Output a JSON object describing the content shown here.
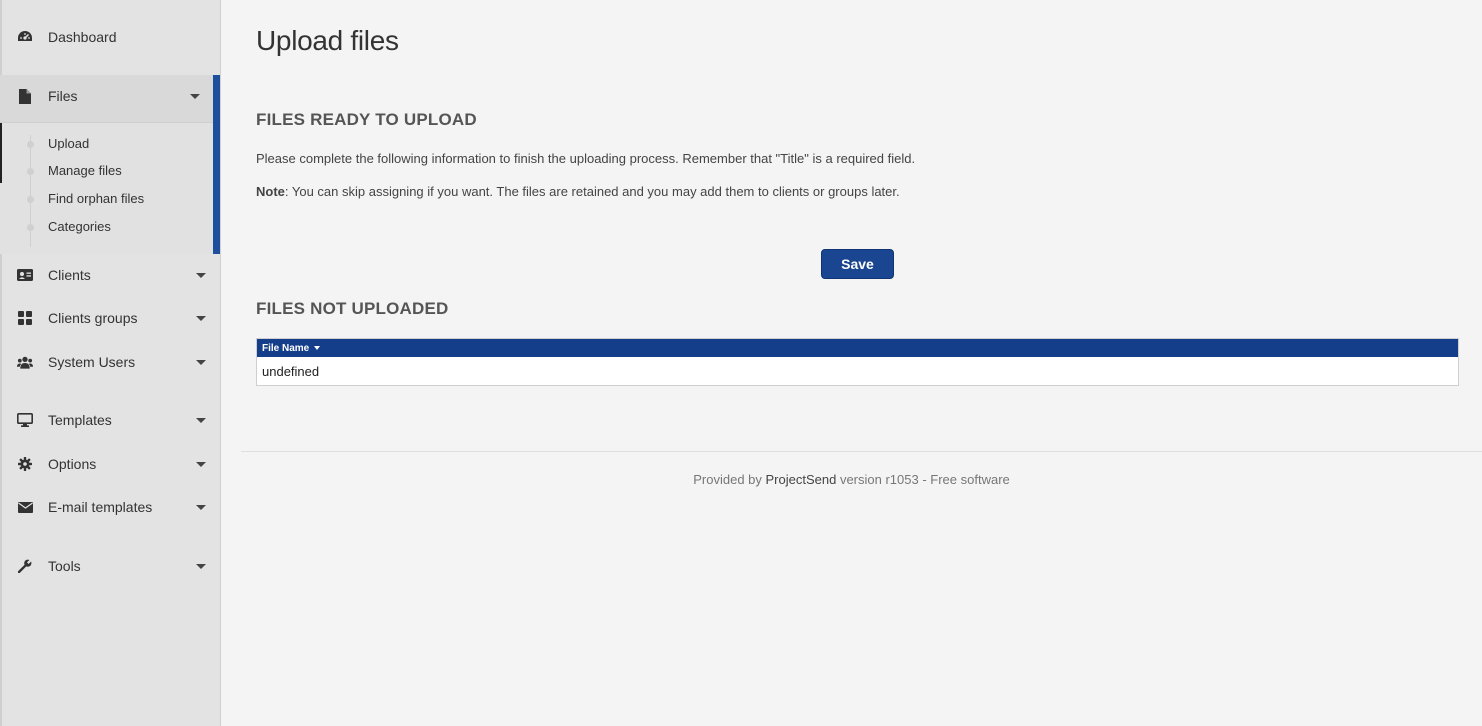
{
  "sidebar": {
    "items": [
      {
        "key": "dashboard",
        "label": "Dashboard",
        "icon": "dashboard-icon",
        "caret": false
      },
      {
        "key": "files",
        "label": "Files",
        "icon": "file-icon",
        "caret": true,
        "expanded": true
      },
      {
        "key": "clients",
        "label": "Clients",
        "icon": "id-card-icon",
        "caret": true
      },
      {
        "key": "clients-groups",
        "label": "Clients groups",
        "icon": "grid-icon",
        "caret": true
      },
      {
        "key": "system-users",
        "label": "System Users",
        "icon": "users-icon",
        "caret": true
      },
      {
        "key": "templates",
        "label": "Templates",
        "icon": "monitor-icon",
        "caret": true
      },
      {
        "key": "options",
        "label": "Options",
        "icon": "gear-icon",
        "caret": true
      },
      {
        "key": "email-templates",
        "label": "E-mail templates",
        "icon": "envelope-icon",
        "caret": true
      },
      {
        "key": "tools",
        "label": "Tools",
        "icon": "wrench-icon",
        "caret": true
      }
    ],
    "files_submenu": [
      "Upload",
      "Manage files",
      "Find orphan files",
      "Categories"
    ]
  },
  "main": {
    "title": "Upload files",
    "ready_heading": "FILES READY TO UPLOAD",
    "instructions": "Please complete the following information to finish the uploading process. Remember that \"Title\" is a required field.",
    "note_label": "Note",
    "note_text": ": You can skip assigning if you want. The files are retained and you may add them to clients or groups later.",
    "save_label": "Save",
    "not_uploaded_heading": "FILES NOT UPLOADED",
    "table": {
      "columns": [
        "File Name"
      ],
      "rows": [
        [
          "undefined"
        ]
      ]
    }
  },
  "footer": {
    "prefix": "Provided by ",
    "brand": "ProjectSend",
    "suffix": " version r1053 - Free software"
  },
  "colors": {
    "accent": "#1e4f9c",
    "button": "#1a4590",
    "table_header": "#143d8a"
  }
}
